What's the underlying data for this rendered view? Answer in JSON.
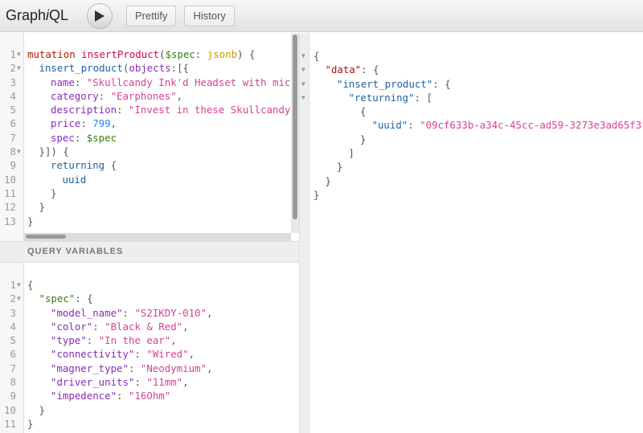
{
  "app": {
    "logo_prefix": "Graph",
    "logo_i": "i",
    "logo_suffix": "QL"
  },
  "toolbar": {
    "prettify": "Prettify",
    "history": "History"
  },
  "variables_title": "QUERY VARIABLES",
  "query": {
    "lines": [
      {
        "n": "1",
        "fold": true,
        "indent": 0,
        "t": [
          [
            "kw",
            "mutation "
          ],
          [
            "def",
            "insertProduct"
          ],
          [
            "p",
            "("
          ],
          [
            "var",
            "$spec"
          ],
          [
            "p",
            ": "
          ],
          [
            "type",
            "jsonb"
          ],
          [
            "p",
            ") {"
          ]
        ]
      },
      {
        "n": "2",
        "fold": true,
        "indent": 1,
        "t": [
          [
            "prop",
            "insert_product"
          ],
          [
            "p",
            "("
          ],
          [
            "attr",
            "objects"
          ],
          [
            "p",
            ":[{"
          ]
        ]
      },
      {
        "n": "3",
        "indent": 2,
        "t": [
          [
            "attr",
            "name"
          ],
          [
            "p",
            ": "
          ],
          [
            "str",
            "\"Skullcandy Ink'd Headset with mic\""
          ],
          [
            "p",
            ","
          ]
        ]
      },
      {
        "n": "4",
        "indent": 2,
        "t": [
          [
            "attr",
            "category"
          ],
          [
            "p",
            ": "
          ],
          [
            "str",
            "\"Earphones\""
          ],
          [
            "p",
            ","
          ]
        ]
      },
      {
        "n": "5",
        "indent": 2,
        "t": [
          [
            "attr",
            "description"
          ],
          [
            "p",
            ": "
          ],
          [
            "str",
            "\"Invest in these Skullcandy In"
          ]
        ]
      },
      {
        "n": "6",
        "indent": 2,
        "t": [
          [
            "attr",
            "price"
          ],
          [
            "p",
            ": "
          ],
          [
            "num",
            "799"
          ],
          [
            "p",
            ","
          ]
        ]
      },
      {
        "n": "7",
        "indent": 2,
        "t": [
          [
            "attr",
            "spec"
          ],
          [
            "p",
            ": "
          ],
          [
            "var",
            "$spec"
          ]
        ]
      },
      {
        "n": "8",
        "fold": true,
        "indent": 1,
        "t": [
          [
            "p",
            "}]) {"
          ]
        ]
      },
      {
        "n": "9",
        "indent": 2,
        "t": [
          [
            "prop",
            "returning"
          ],
          [
            "p",
            " {"
          ]
        ]
      },
      {
        "n": "10",
        "indent": 3,
        "t": [
          [
            "prop",
            "uuid"
          ]
        ]
      },
      {
        "n": "11",
        "indent": 2,
        "t": [
          [
            "p",
            "}"
          ]
        ]
      },
      {
        "n": "12",
        "indent": 1,
        "t": [
          [
            "p",
            "}"
          ]
        ]
      },
      {
        "n": "13",
        "indent": 0,
        "t": [
          [
            "p",
            "}"
          ]
        ]
      }
    ]
  },
  "variables": {
    "lines": [
      {
        "n": "1",
        "fold": true,
        "indent": 0,
        "t": [
          [
            "p",
            "{"
          ]
        ]
      },
      {
        "n": "2",
        "fold": true,
        "indent": 1,
        "t": [
          [
            "var",
            "\"spec\""
          ],
          [
            "p",
            ": {"
          ]
        ]
      },
      {
        "n": "3",
        "indent": 2,
        "t": [
          [
            "attr",
            "\"model_name\""
          ],
          [
            "p",
            ": "
          ],
          [
            "str",
            "\"S2IKDY-010\""
          ],
          [
            "p",
            ","
          ]
        ]
      },
      {
        "n": "4",
        "indent": 2,
        "t": [
          [
            "attr",
            "\"color\""
          ],
          [
            "p",
            ": "
          ],
          [
            "str",
            "\"Black & Red\""
          ],
          [
            "p",
            ","
          ]
        ]
      },
      {
        "n": "5",
        "indent": 2,
        "t": [
          [
            "attr",
            "\"type\""
          ],
          [
            "p",
            ": "
          ],
          [
            "str",
            "\"In the ear\""
          ],
          [
            "p",
            ","
          ]
        ]
      },
      {
        "n": "6",
        "indent": 2,
        "t": [
          [
            "attr",
            "\"connectivity\""
          ],
          [
            "p",
            ": "
          ],
          [
            "str",
            "\"Wired\""
          ],
          [
            "p",
            ","
          ]
        ]
      },
      {
        "n": "7",
        "indent": 2,
        "t": [
          [
            "attr",
            "\"magner_type\""
          ],
          [
            "p",
            ": "
          ],
          [
            "str",
            "\"Neodymium\""
          ],
          [
            "p",
            ","
          ]
        ]
      },
      {
        "n": "8",
        "indent": 2,
        "t": [
          [
            "attr",
            "\"driver_units\""
          ],
          [
            "p",
            ": "
          ],
          [
            "str",
            "\"11mm\""
          ],
          [
            "p",
            ","
          ]
        ]
      },
      {
        "n": "9",
        "indent": 2,
        "t": [
          [
            "attr",
            "\"impedence\""
          ],
          [
            "p",
            ": "
          ],
          [
            "str",
            "\"16Ohm\""
          ]
        ]
      },
      {
        "n": "10",
        "indent": 1,
        "t": [
          [
            "p",
            "}"
          ]
        ]
      },
      {
        "n": "11",
        "indent": 0,
        "t": [
          [
            "p",
            "}"
          ]
        ]
      }
    ]
  },
  "result": {
    "lines": [
      {
        "fold": true,
        "indent": 0,
        "t": [
          [
            "p",
            "{"
          ]
        ]
      },
      {
        "fold": true,
        "indent": 1,
        "t": [
          [
            "key",
            "\"data\""
          ],
          [
            "p",
            ": {"
          ]
        ]
      },
      {
        "fold": true,
        "indent": 2,
        "t": [
          [
            "rkey",
            "\"insert_product\""
          ],
          [
            "p",
            ": {"
          ]
        ]
      },
      {
        "fold": true,
        "indent": 3,
        "t": [
          [
            "rkey",
            "\"returning\""
          ],
          [
            "p",
            ": ["
          ]
        ]
      },
      {
        "indent": 4,
        "t": [
          [
            "p",
            "{"
          ]
        ]
      },
      {
        "indent": 5,
        "t": [
          [
            "rkey",
            "\"uuid\""
          ],
          [
            "p",
            ": "
          ],
          [
            "str",
            "\"09cf633b-a34c-45cc-ad59-3273e3ad65f3\""
          ]
        ]
      },
      {
        "indent": 4,
        "t": [
          [
            "p",
            "}"
          ]
        ]
      },
      {
        "indent": 3,
        "t": [
          [
            "p",
            "]"
          ]
        ]
      },
      {
        "indent": 2,
        "t": [
          [
            "p",
            "}"
          ]
        ]
      },
      {
        "indent": 1,
        "t": [
          [
            "p",
            "}"
          ]
        ]
      },
      {
        "indent": 0,
        "t": [
          [
            "p",
            "}"
          ]
        ]
      }
    ]
  }
}
